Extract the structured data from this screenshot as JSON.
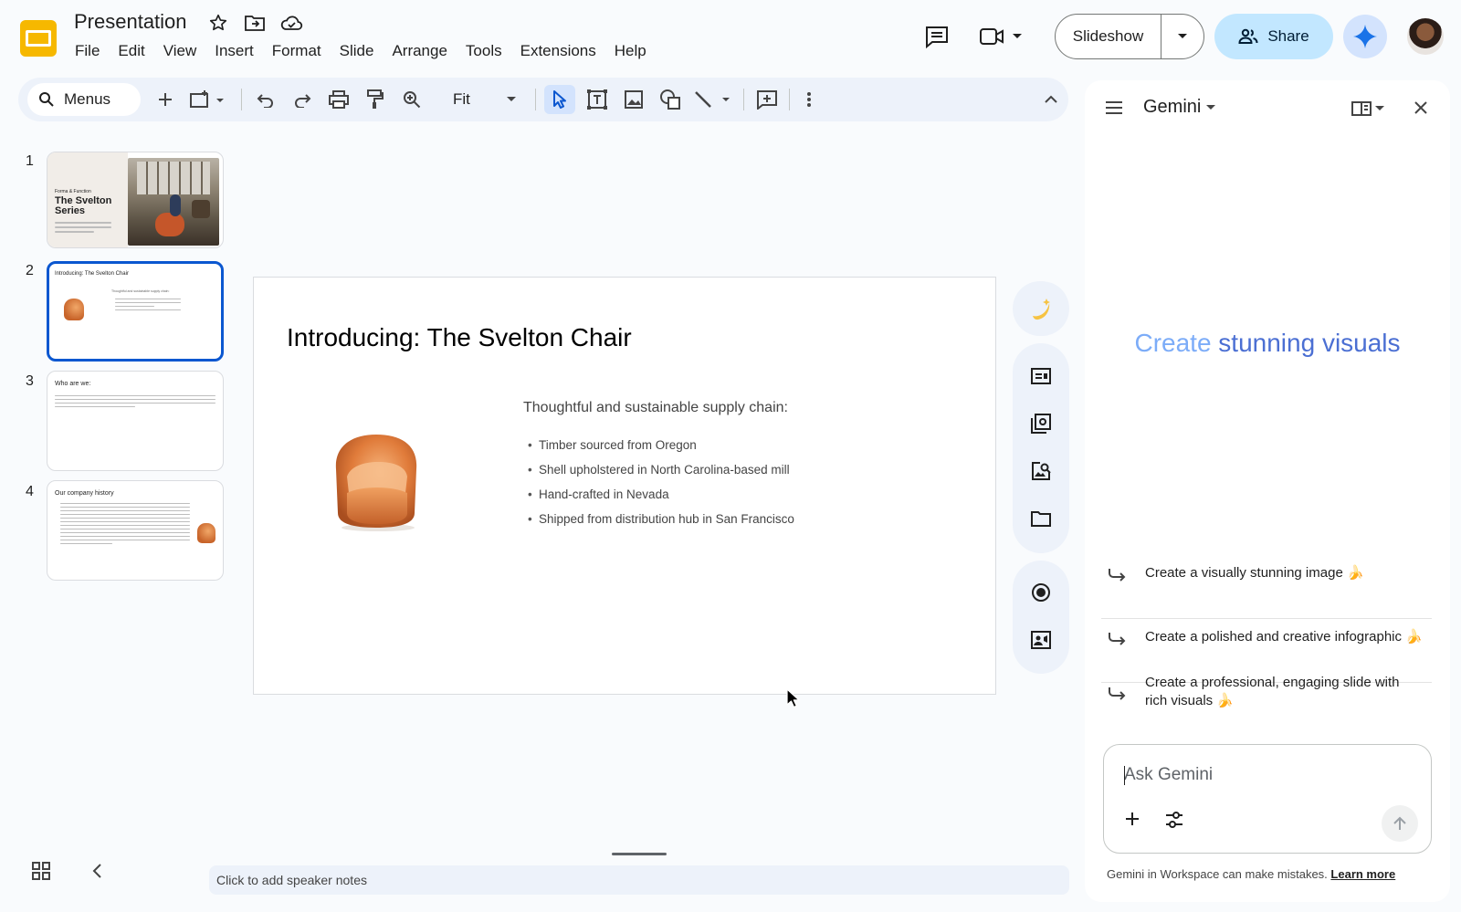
{
  "app": {
    "title": "Presentation",
    "menu": [
      "File",
      "Edit",
      "View",
      "Insert",
      "Format",
      "Slide",
      "Arrange",
      "Tools",
      "Extensions",
      "Help"
    ]
  },
  "header": {
    "slideshow_label": "Slideshow",
    "share_label": "Share"
  },
  "toolbar": {
    "search_label": "Menus",
    "zoom_label": "Fit"
  },
  "filmstrip": {
    "slides": [
      {
        "number": "1",
        "kicker": "Forma & Function",
        "title": "The Svelton Series"
      },
      {
        "number": "2",
        "title": "Introducing: The Svelton Chair",
        "subtitle": "Thoughtful and sustainable supply chain:"
      },
      {
        "number": "3",
        "title": "Who are we:"
      },
      {
        "number": "4",
        "title": "Our company history"
      }
    ]
  },
  "slide": {
    "title": "Introducing: The Svelton Chair",
    "subtitle": "Thoughtful and sustainable supply chain:",
    "bullets": [
      "Timber sourced from Oregon",
      "Shell upholstered in North Carolina-based mill",
      "Hand-crafted in Nevada",
      "Shipped from distribution hub in San Francisco"
    ]
  },
  "notes": {
    "placeholder": "Click to add speaker notes"
  },
  "gemini": {
    "title": "Gemini",
    "hero_part1": "Create ",
    "hero_part2": "stunning visuals",
    "suggestions": [
      {
        "line1": "Create a visually stunning image 🍌",
        "line2": ""
      },
      {
        "line1": "Create a polished and creative infographic 🍌",
        "line2": ""
      },
      {
        "line1": "Create a professional, engaging slide with",
        "line2": "rich visuals 🍌"
      }
    ],
    "input_placeholder": "Ask Gemini",
    "disclaimer": "Gemini in Workspace can make mistakes.",
    "learn_more": "Learn more"
  },
  "colors": {
    "accent_blue": "#0b57d0",
    "share_bg": "#c2e7ff",
    "toolbar_bg": "#edf2fa",
    "hero_light": "#7cacf8",
    "hero_dark": "#4b6fd3"
  }
}
